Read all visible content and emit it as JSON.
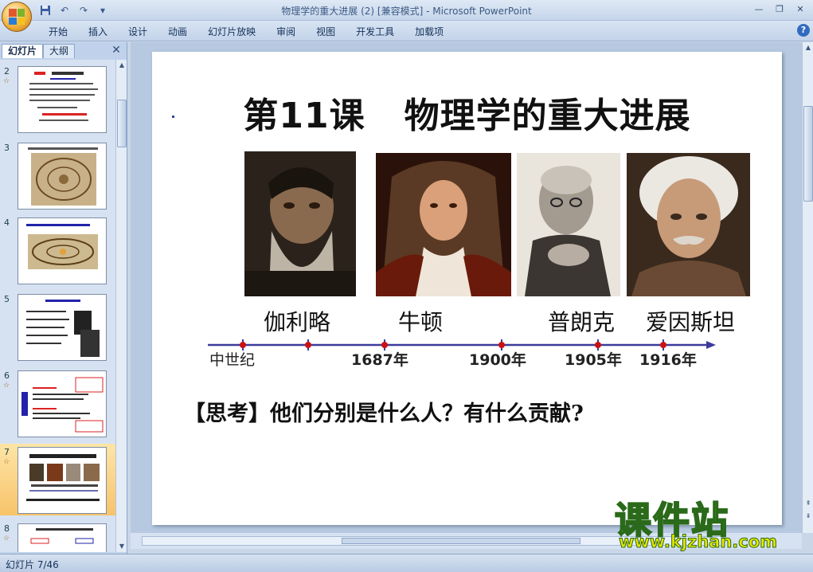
{
  "window": {
    "title": "物理学的重大进展 (2) [兼容模式] - Microsoft PowerPoint"
  },
  "ribbon": {
    "tabs": [
      "开始",
      "插入",
      "设计",
      "动画",
      "幻灯片放映",
      "审阅",
      "视图",
      "开发工具",
      "加载项"
    ]
  },
  "left_pane": {
    "tabs": [
      "幻灯片",
      "大纲"
    ],
    "slides": [
      {
        "number": "2"
      },
      {
        "number": "3"
      },
      {
        "number": "4"
      },
      {
        "number": "5"
      },
      {
        "number": "6"
      },
      {
        "number": "7"
      },
      {
        "number": "8"
      }
    ],
    "selected_slide": "7"
  },
  "slide": {
    "title": "第11课   物理学的重大进展",
    "scientists": [
      {
        "name": "伽利略"
      },
      {
        "name": "牛顿"
      },
      {
        "name": "普朗克"
      },
      {
        "name": "爱因斯坦"
      }
    ],
    "timeline": [
      "中世纪",
      "1687年",
      "1900年",
      "1905年",
      "1916年"
    ],
    "question": "【思考】他们分别是什么人？有什么贡献?"
  },
  "status": {
    "slide_counter": "幻灯片 7/46"
  },
  "watermark": {
    "brand": "课件站",
    "url": "www.kjzhan.com"
  },
  "colors": {
    "timeline_line": "#3b3b9a",
    "timeline_dot": "#cc1111",
    "watermark_fill": "#e8e800"
  }
}
